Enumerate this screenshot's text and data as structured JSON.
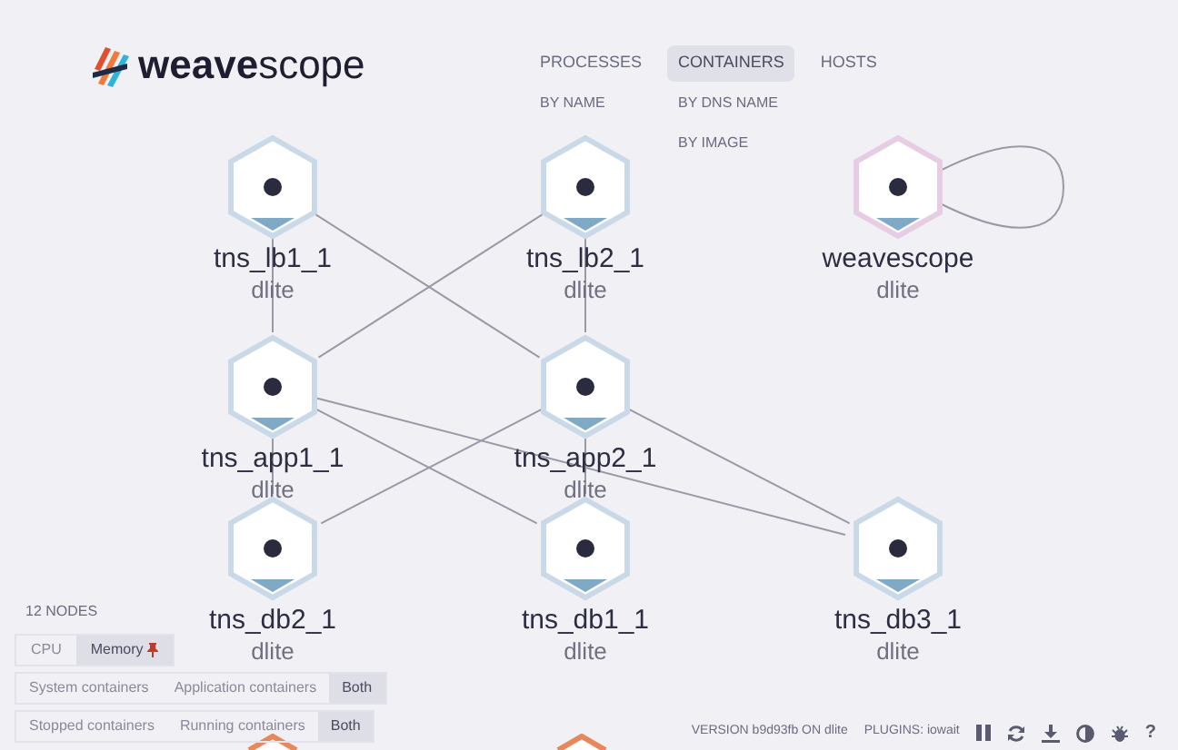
{
  "logo": {
    "text": "**weave**scope"
  },
  "topologies": [
    {
      "label": "PROCESSES",
      "selected": false,
      "sub_options": [
        {
          "label": "BY NAME"
        }
      ]
    },
    {
      "label": "CONTAINERS",
      "selected": true,
      "sub_options": [
        {
          "label": "BY DNS NAME"
        },
        {
          "label": "BY IMAGE"
        }
      ]
    },
    {
      "label": "HOSTS",
      "selected": false
    }
  ],
  "nodes": [
    {
      "kind": "node",
      "label": "tns_lb1_1",
      "sublabel": "dlite",
      "color": "#c9d9e8"
    },
    {
      "kind": "node",
      "label": "tns_lb2_1",
      "sublabel": "dlite",
      "color": "#c9d9e8"
    },
    {
      "kind": "node",
      "label": "weavescope",
      "sublabel": "dlite",
      "color": "#e6cde3"
    },
    {
      "kind": "node",
      "label": "tns_app1_1",
      "sublabel": "dlite",
      "color": "#c9d9e8"
    },
    {
      "kind": "node",
      "label": "tns_app2_1",
      "sublabel": "dlite",
      "color": "#c9d9e8"
    },
    {
      "kind": "node",
      "label": "tns_db2_1",
      "sublabel": "dlite",
      "color": "#c9d9e8"
    },
    {
      "kind": "node",
      "label": "tns_db1_1",
      "sublabel": "dlite",
      "color": "#c9d9e8"
    },
    {
      "kind": "node",
      "label": "tns_db3_1",
      "sublabel": "dlite",
      "color": "#c9d9e8"
    },
    {
      "kind": "cut",
      "color": "#e8875a"
    },
    {
      "kind": "cut",
      "color": "#e8875a"
    }
  ],
  "node_count": "12 NODES",
  "metrics": [
    {
      "label": "CPU",
      "selected": false,
      "pinned": false
    },
    {
      "label": "Memory",
      "selected": true,
      "pinned": true
    }
  ],
  "filters": [
    {
      "options": [
        {
          "label": "System containers",
          "selected": false
        },
        {
          "label": "Application containers",
          "selected": false
        },
        {
          "label": "Both",
          "selected": true
        }
      ]
    },
    {
      "options": [
        {
          "label": "Stopped containers",
          "selected": false
        },
        {
          "label": "Running containers",
          "selected": false
        },
        {
          "label": "Both",
          "selected": true
        }
      ]
    }
  ],
  "footer": {
    "version": "VERSION b9d93fb ON dlite",
    "plugins": "PLUGINS: iowait",
    "help": "?"
  }
}
